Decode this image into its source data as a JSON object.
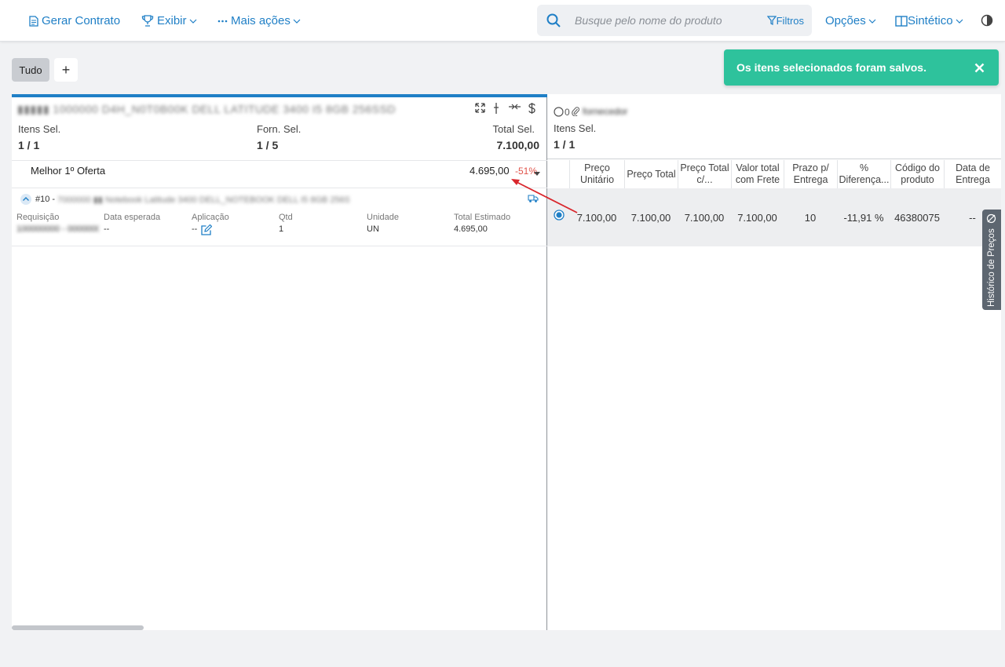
{
  "toolbar": {
    "gerar_contrato": "Gerar Contrato",
    "exibir": "Exibir",
    "mais_acoes": "Mais ações",
    "opcoes": "Opções",
    "sintetico": "Sintético"
  },
  "search": {
    "placeholder": "Busque pelo nome do produto",
    "filtros": "Filtros"
  },
  "tabs": {
    "tudo": "Tudo",
    "add": "+"
  },
  "toast": {
    "message": "Os itens selecionados foram salvos."
  },
  "left": {
    "title": "▮▮▮▮▮ 1000000 D4H_N0T0B00K DELL LATITUDE 3400 I5 8GB 256SSD",
    "itens_sel_label": "Itens Sel.",
    "itens_sel_value": "1 / 1",
    "forn_sel_label": "Forn. Sel.",
    "forn_sel_value": "1 / 5",
    "total_sel_label": "Total Sel.",
    "total_sel_value": "7.100,00",
    "melhor_oferta_label": "Melhor 1º Oferta",
    "melhor_oferta_value": "4.695,00",
    "melhor_oferta_pct": "-51%",
    "item": {
      "number": "#10 -",
      "desc": "7000000 ▮▮ Notebook Latitude 3400 DELL_NOTEBOOK DELL I5 8GB 256SSD",
      "cols": [
        {
          "label": "Requisição",
          "value": "100000000 - 0000000"
        },
        {
          "label": "Data esperada",
          "value": "--"
        },
        {
          "label": "Aplicação",
          "value": "--"
        },
        {
          "label": "Qtd",
          "value": "1"
        },
        {
          "label": "Unidade",
          "value": "UN"
        },
        {
          "label": "Total Estimado",
          "value": "4.695,00"
        }
      ]
    }
  },
  "right": {
    "attach_count": "0",
    "supplier_blur": "fornecedor",
    "itens_sel_label": "Itens Sel.",
    "itens_sel_value": "1 / 1",
    "headers": [
      "Preço Unitário",
      "Preço Total",
      "Preço Total c/...",
      "Valor total com Frete",
      "Prazo p/ Entrega",
      "% Diferença...",
      "Código do produto",
      "Data de Entrega"
    ],
    "row": [
      "7.100,00",
      "7.100,00",
      "7.100,00",
      "7.100,00",
      "10",
      "-11,91 %",
      "46380075",
      "--"
    ]
  },
  "side_tab": {
    "label": "Histórico de Preços"
  },
  "colors": {
    "accent": "#1f7fc6",
    "toast": "#2ec29c",
    "negative": "#e0534a",
    "arrow": "#d9262c"
  }
}
